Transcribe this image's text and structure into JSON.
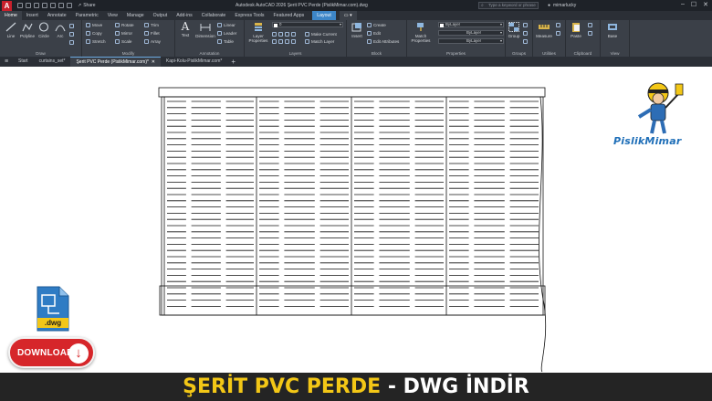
{
  "titlebar": {
    "app_logo": "A",
    "share_label": "Share",
    "title": "Autodesk AutoCAD 2026   Şerit PVC Perde (PislikMimar.com).dwg",
    "search_placeholder": "Type a keyword or phrase",
    "username": "mimarlucky",
    "win_min": "–",
    "win_max": "☐",
    "win_close": "✕"
  },
  "ribbon_tabs": [
    "Home",
    "Insert",
    "Annotate",
    "Parametric",
    "View",
    "Manage",
    "Output",
    "Add-ins",
    "Collaborate",
    "Express Tools",
    "Featured Apps"
  ],
  "ribbon_tab_layout": "Layout",
  "ribbon": {
    "draw": {
      "title": "Draw",
      "line": "Line",
      "polyline": "Polyline",
      "circle": "Circle",
      "arc": "Arc"
    },
    "modify": {
      "title": "Modify",
      "move": "Move",
      "rotate": "Rotate",
      "trim": "Trim",
      "copy": "Copy",
      "mirror": "Mirror",
      "fillet": "Fillet",
      "stretch": "Stretch",
      "scale": "Scale",
      "array": "Array"
    },
    "annotation": {
      "title": "Annotation",
      "text": "Text",
      "dimension": "Dimension",
      "linear": "Linear",
      "leader": "Leader",
      "table": "Table"
    },
    "layers": {
      "title": "Layers",
      "layer_properties": "Layer Properties",
      "layer_value": "0",
      "make_current": "Make Current",
      "match_layer": "Match Layer"
    },
    "block": {
      "title": "Block",
      "insert": "Insert",
      "create": "Create",
      "edit": "Edit",
      "edit_attributes": "Edit Attributes"
    },
    "properties": {
      "title": "Properties",
      "match_properties": "Match Properties",
      "color": "ByLayer",
      "linetype": "ByLayer",
      "lineweight": "ByLayer"
    },
    "groups": {
      "title": "Groups",
      "group": "Group"
    },
    "utilities": {
      "title": "Utilities",
      "measure": "Measure"
    },
    "clipboard": {
      "title": "Clipboard",
      "paste": "Paste"
    },
    "view": {
      "title": "View",
      "base": "Base"
    }
  },
  "doc_tabs": {
    "start": "Start",
    "tab1": "curtains_set*",
    "tab2": "Şerit PVC Perde (PislikMimar.com)*",
    "tab3": "Kapi-Kolu-PislikMimar.com*"
  },
  "brand": "PislikMimar",
  "dwg_label": ".dwg",
  "download_label": "DOWNLOAD",
  "banner": {
    "part1": "ŞERİT PVC PERDE",
    "part2": " - DWG İNDİR"
  },
  "colors": {
    "accent": "#3d86c8",
    "banner_yellow": "#f3c716",
    "download_red": "#d6262a",
    "brand_blue": "#1f6fb8"
  }
}
